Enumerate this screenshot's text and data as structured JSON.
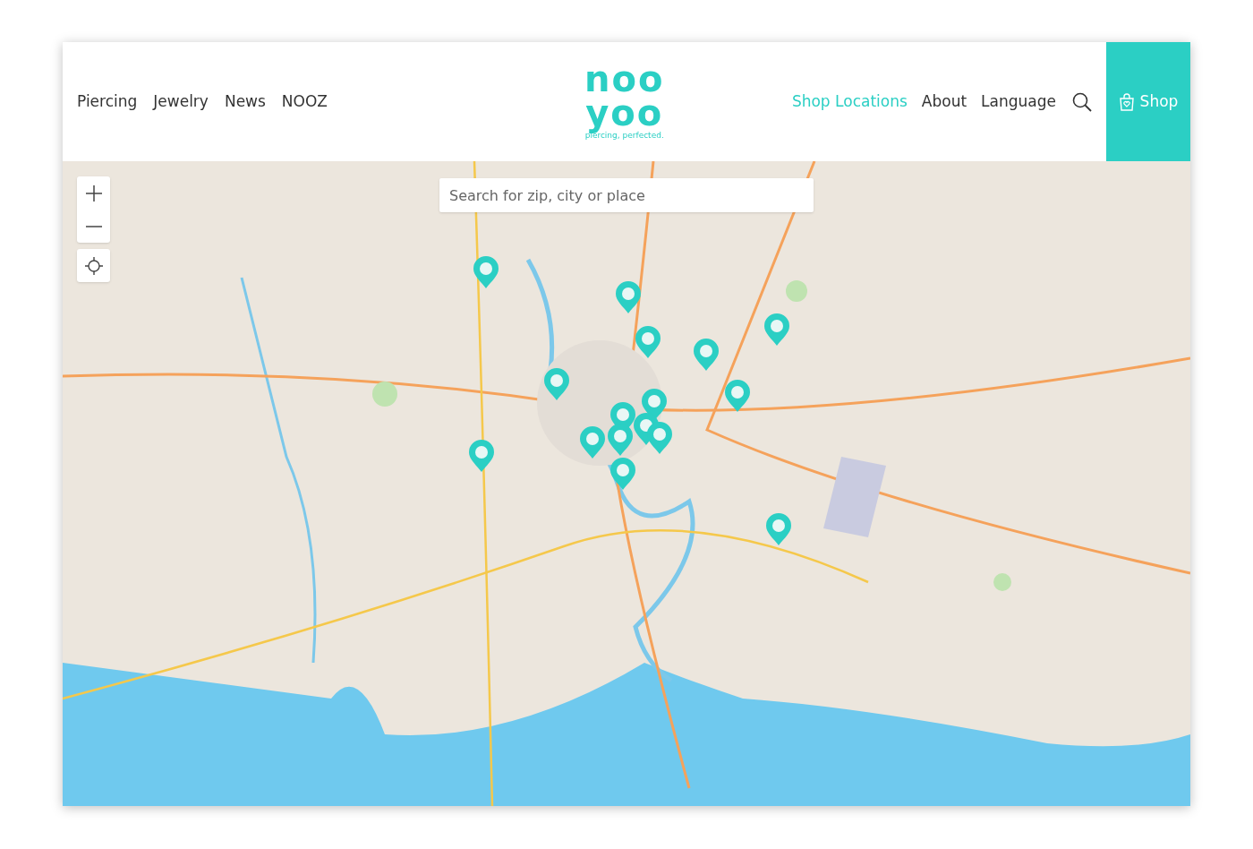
{
  "nav_left": [
    {
      "label": "Piercing",
      "selected": false
    },
    {
      "label": "Jewelry",
      "selected": false
    },
    {
      "label": "News",
      "selected": false
    },
    {
      "label": "NOOZ",
      "selected": false
    }
  ],
  "logo": {
    "top": "noo",
    "bottom": "yoo",
    "tagline": "piercing, perfected."
  },
  "nav_right": [
    {
      "label": "Shop Locations",
      "selected": true
    },
    {
      "label": "About",
      "selected": false
    },
    {
      "label": "Language",
      "selected": false
    }
  ],
  "shop_button": {
    "label": "Shop"
  },
  "map": {
    "kind": "picture",
    "search": {
      "placeholder": "Search for zip, city or place"
    }
  }
}
